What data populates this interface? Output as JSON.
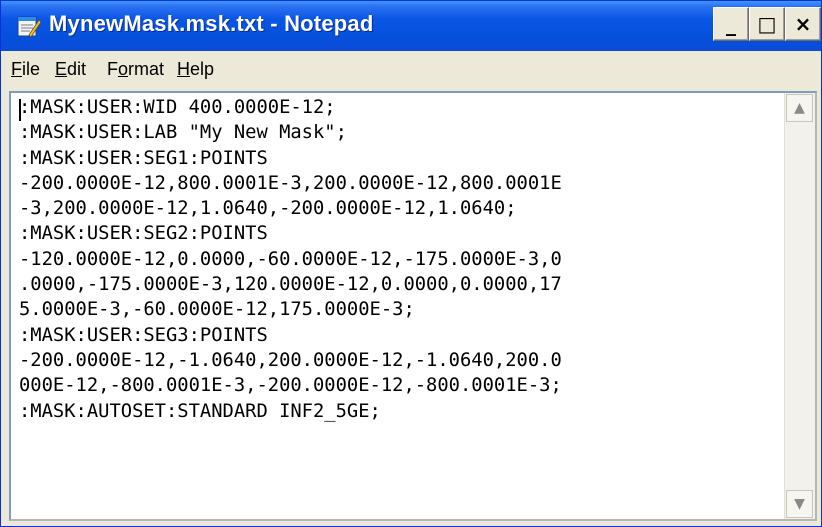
{
  "window": {
    "title": "MynewMask.msk.txt - Notepad",
    "icon": "notepad-icon",
    "controls": {
      "minimize": "_",
      "maximize": "□",
      "close": "×"
    }
  },
  "menu": {
    "file_pre": "",
    "file_key": "F",
    "file_post": "ile",
    "edit_pre": "",
    "edit_key": "E",
    "edit_post": "dit",
    "format_pre": "F",
    "format_key": "o",
    "format_post": "rmat",
    "help_pre": "",
    "help_key": "H",
    "help_post": "elp"
  },
  "editor": {
    "lines": [
      ":MASK:USER:WID 400.0000E-12;",
      ":MASK:USER:LAB \"My New Mask\";",
      ":MASK:USER:SEG1:POINTS",
      "-200.0000E-12,800.0001E-3,200.0000E-12,800.0001E",
      "-3,200.0000E-12,1.0640,-200.0000E-12,1.0640;",
      ":MASK:USER:SEG2:POINTS",
      "-120.0000E-12,0.0000,-60.0000E-12,-175.0000E-3,0",
      ".0000,-175.0000E-3,120.0000E-12,0.0000,0.0000,17",
      "5.0000E-3,-60.0000E-12,175.0000E-3;",
      ":MASK:USER:SEG3:POINTS",
      "-200.0000E-12,-1.0640,200.0000E-12,-1.0640,200.0",
      "000E-12,-800.0001E-3,-200.0000E-12,-800.0001E-3;",
      ":MASK:AUTOSET:STANDARD INF2_5GE;"
    ]
  },
  "scrollbar": {
    "up": "▲",
    "down": "▼"
  }
}
